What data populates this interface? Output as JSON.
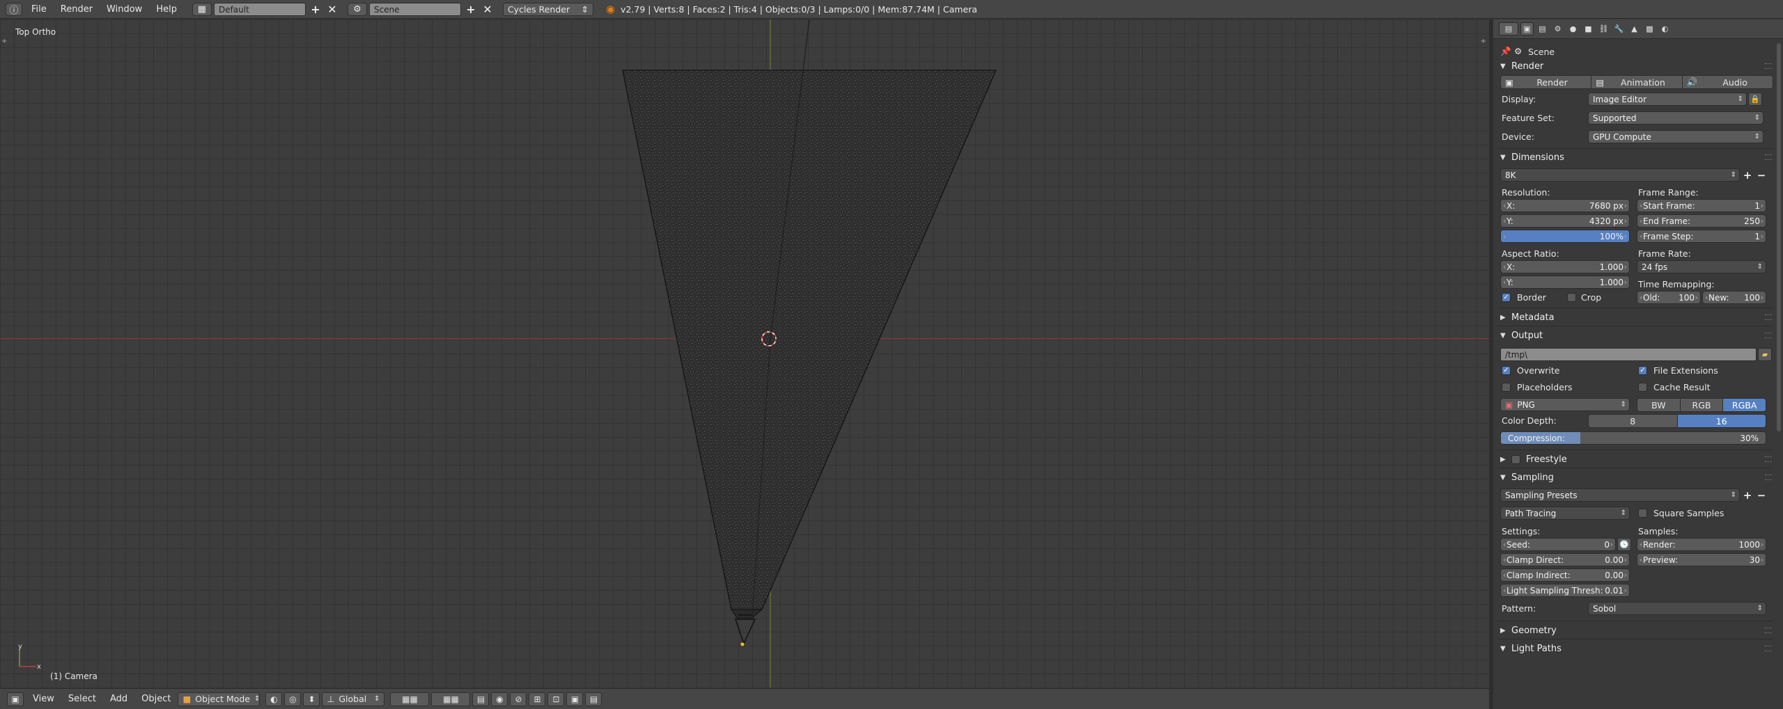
{
  "topbar": {
    "menus": [
      "File",
      "Render",
      "Window",
      "Help"
    ],
    "layout_name": "Default",
    "scene_name": "Scene",
    "engine": "Cycles Render",
    "stats": "v2.79 | Verts:8 | Faces:2 | Tris:4 | Objects:0/3 | Lamps:0/0 | Mem:87.74M | Camera"
  },
  "viewport": {
    "view_name": "Top Ortho",
    "object_label": "(1) Camera",
    "axis_x": "x",
    "axis_y": "y"
  },
  "footer": {
    "menus": [
      "View",
      "Select",
      "Add",
      "Object"
    ],
    "mode": "Object Mode",
    "orientation": "Global"
  },
  "props": {
    "context": "Scene",
    "render": {
      "title": "Render",
      "buttons": [
        "Render",
        "Animation",
        "Audio"
      ],
      "display_label": "Display:",
      "display_value": "Image Editor",
      "feature_label": "Feature Set:",
      "feature_value": "Supported",
      "device_label": "Device:",
      "device_value": "GPU Compute"
    },
    "dimensions": {
      "title": "Dimensions",
      "preset": "8K",
      "resolution_label": "Resolution:",
      "res_x_label": "X:",
      "res_x": "7680 px",
      "res_y_label": "Y:",
      "res_y": "4320 px",
      "res_pct": "100%",
      "frame_range_label": "Frame Range:",
      "start_label": "Start Frame:",
      "start": "1",
      "end_label": "End Frame:",
      "end": "250",
      "step_label": "Frame Step:",
      "step": "1",
      "aspect_label": "Aspect Ratio:",
      "asp_x_label": "X:",
      "asp_x": "1.000",
      "asp_y_label": "Y:",
      "asp_y": "1.000",
      "frame_rate_label": "Frame Rate:",
      "frame_rate": "24 fps",
      "time_remap_label": "Time Remapping:",
      "old_label": "Old:",
      "old": "100",
      "new_label": "New:",
      "new": "100",
      "border_label": "Border",
      "crop_label": "Crop"
    },
    "metadata": {
      "title": "Metadata"
    },
    "output": {
      "title": "Output",
      "path": "/tmp\\",
      "overwrite_label": "Overwrite",
      "file_ext_label": "File Extensions",
      "placeholders_label": "Placeholders",
      "cache_label": "Cache Result",
      "format": "PNG",
      "color_modes": [
        "BW",
        "RGB",
        "RGBA"
      ],
      "color_depth_label": "Color Depth:",
      "depths": [
        "8",
        "16"
      ],
      "compression_label": "Compression:",
      "compression": "30%",
      "compression_fraction": 0.3
    },
    "freestyle": {
      "title": "Freestyle"
    },
    "sampling": {
      "title": "Sampling",
      "presets": "Sampling Presets",
      "integrator": "Path Tracing",
      "square_label": "Square Samples",
      "settings_label": "Settings:",
      "seed_label": "Seed:",
      "seed": "0",
      "clamp_direct_label": "Clamp Direct:",
      "clamp_direct": "0.00",
      "clamp_indirect_label": "Clamp Indirect:",
      "clamp_indirect": "0.00",
      "light_thresh_label": "Light Sampling Thresh:",
      "light_thresh": "0.01",
      "samples_label": "Samples:",
      "render_label": "Render:",
      "render": "1000",
      "preview_label": "Preview:",
      "preview": "30",
      "pattern_label": "Pattern:",
      "pattern": "Sobol"
    },
    "geometry": {
      "title": "Geometry"
    },
    "light_paths": {
      "title": "Light Paths"
    }
  },
  "colors": {
    "accent": "#5680c2",
    "viewport_bg": "#3d3d3d",
    "x_axis": "#b03a3a",
    "y_axis": "#8a9a2a"
  }
}
